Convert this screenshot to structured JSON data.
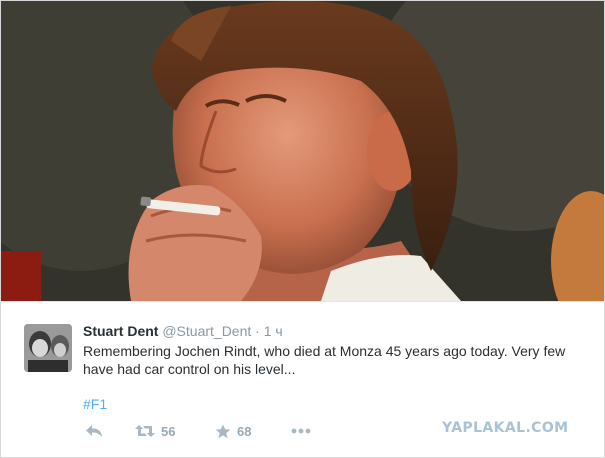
{
  "tweet": {
    "author_name": "Stuart Dent",
    "author_handle": "@Stuart_Dent",
    "separator": "·",
    "time": "1 ч",
    "text": "Remembering Jochen Rindt, who died at Monza 45 years ago today. Very few have had car control on his level...",
    "hashtag": "#F1"
  },
  "actions": {
    "reply_icon": "reply-icon",
    "retweet_icon": "retweet-icon",
    "retweet_count": "56",
    "favorite_icon": "star-icon",
    "favorite_count": "68",
    "more_icon": "more-icon"
  },
  "watermark": "YAPLAKAL.COM",
  "colors": {
    "link": "#55acee",
    "name": "#292f33",
    "muted": "#8899a6",
    "action": "#aab8c2",
    "watermark": "#a9c3d6"
  }
}
